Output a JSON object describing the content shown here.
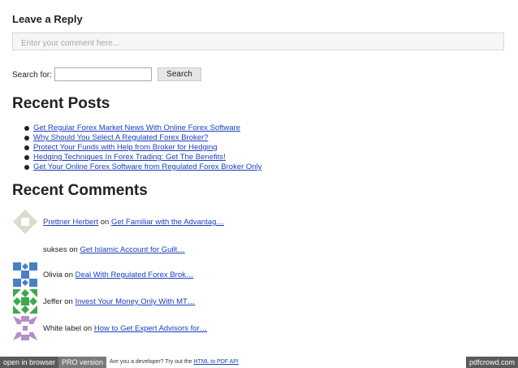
{
  "reply": {
    "title": "Leave a Reply",
    "placeholder": "Enter your comment here..."
  },
  "search": {
    "label": "Search for:",
    "value": "",
    "button": "Search"
  },
  "recent_posts": {
    "title": "Recent Posts",
    "items": [
      "Get Regular Forex Market News With Online Forex Software",
      "Why Should You Select A Regulated Forex Broker?",
      "Protect Your Funds with Help from Broker for Hedging",
      "Hedging Techniques In Forex Trading: Get The Benefits!",
      "Get Your Online Forex Software from Regulated Forex Broker Only"
    ]
  },
  "recent_comments": {
    "title": "Recent Comments",
    "items": [
      {
        "author": "Prettner Herbert",
        "author_link": true,
        "on": "on",
        "post": "Get Familiar with the Advantag…",
        "avatar_color": "#d9dccb"
      },
      {
        "author": "sukses",
        "author_link": false,
        "on": "on",
        "post": "Get Islamic Account for Guilt…",
        "avatar_color": ""
      },
      {
        "author": "Olivia",
        "author_link": false,
        "on": "on",
        "post": "Deal With Regulated Forex Brok…",
        "avatar_color": "#4a7fc4"
      },
      {
        "author": "Jeffer",
        "author_link": false,
        "on": "on",
        "post": "Invest Your Money Only With MT…",
        "avatar_color": "#3fa84f"
      },
      {
        "author": "White label",
        "author_link": false,
        "on": "on",
        "post": "How to Get Expert Advisors for…",
        "avatar_color": "#b48ec9"
      }
    ]
  },
  "footer": {
    "open_in_browser": "open in browser",
    "pro_version": "PRO version",
    "message_prefix": "Are you a developer? Try out the",
    "message_link": "HTML to PDF API",
    "brand": "pdfcrowd.com"
  }
}
